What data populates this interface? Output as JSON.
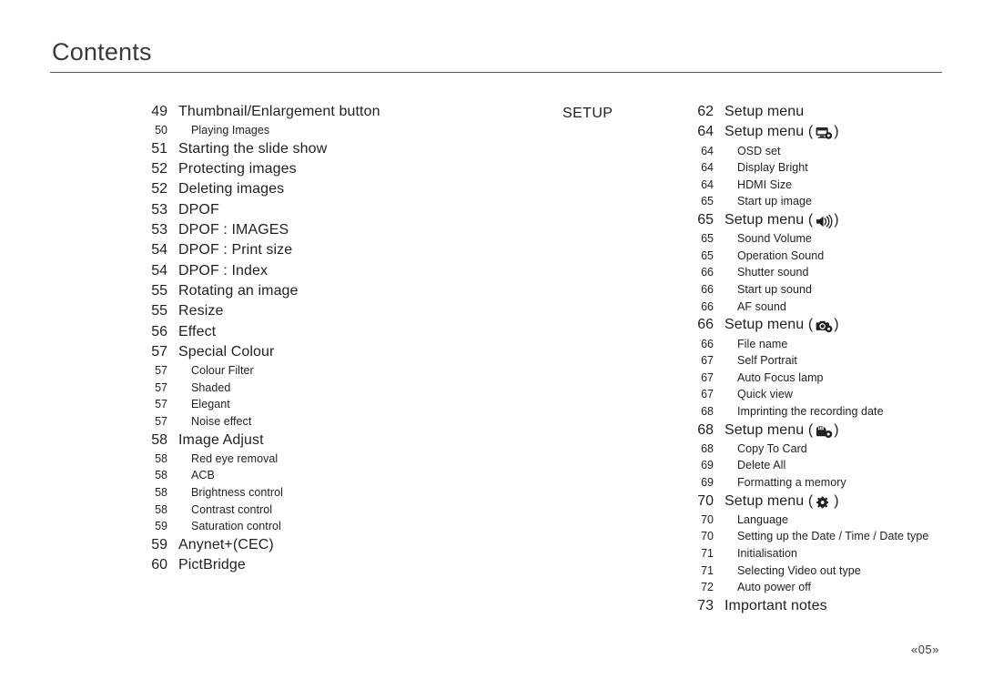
{
  "header": {
    "title": "Contents"
  },
  "footer": {
    "page_marker": "«05»"
  },
  "columns": {
    "left": {
      "section_label": "",
      "entries": [
        {
          "level": 1,
          "num": "49",
          "label": "Thumbnail/Enlargement button"
        },
        {
          "level": 2,
          "num": "50",
          "label": "Playing Images"
        },
        {
          "level": 1,
          "num": "51",
          "label": "Starting the slide show"
        },
        {
          "level": 1,
          "num": "52",
          "label": "Protecting images"
        },
        {
          "level": 1,
          "num": "52",
          "label": "Deleting images"
        },
        {
          "level": 1,
          "num": "53",
          "label": "DPOF"
        },
        {
          "level": 1,
          "num": "53",
          "label": "DPOF : IMAGES"
        },
        {
          "level": 1,
          "num": "54",
          "label": "DPOF : Print size"
        },
        {
          "level": 1,
          "num": "54",
          "label": "DPOF : Index"
        },
        {
          "level": 1,
          "num": "55",
          "label": "Rotating an image"
        },
        {
          "level": 1,
          "num": "55",
          "label": "Resize"
        },
        {
          "level": 1,
          "num": "56",
          "label": "Effect"
        },
        {
          "level": 1,
          "num": "57",
          "label": "Special Colour"
        },
        {
          "level": 2,
          "num": "57",
          "label": "Colour Filter"
        },
        {
          "level": 2,
          "num": "57",
          "label": "Shaded"
        },
        {
          "level": 2,
          "num": "57",
          "label": "Elegant"
        },
        {
          "level": 2,
          "num": "57",
          "label": "Noise effect"
        },
        {
          "level": 1,
          "num": "58",
          "label": "Image Adjust"
        },
        {
          "level": 2,
          "num": "58",
          "label": "Red eye removal"
        },
        {
          "level": 2,
          "num": "58",
          "label": "ACB"
        },
        {
          "level": 2,
          "num": "58",
          "label": "Brightness control"
        },
        {
          "level": 2,
          "num": "58",
          "label": "Contrast control"
        },
        {
          "level": 2,
          "num": "59",
          "label": "Saturation control"
        },
        {
          "level": 1,
          "num": "59",
          "label": "Anynet+(CEC)"
        },
        {
          "level": 1,
          "num": "60",
          "label": "PictBridge"
        }
      ]
    },
    "right": {
      "section_label": "SETUP",
      "entries": [
        {
          "level": 1,
          "num": "62",
          "label": "Setup menu"
        },
        {
          "level": 1,
          "num": "64",
          "label": "Setup menu",
          "icon": "display-settings-icon"
        },
        {
          "level": 2,
          "num": "64",
          "label": "OSD set"
        },
        {
          "level": 2,
          "num": "64",
          "label": "Display Bright"
        },
        {
          "level": 2,
          "num": "64",
          "label": "HDMI Size"
        },
        {
          "level": 2,
          "num": "65",
          "label": "Start up image"
        },
        {
          "level": 1,
          "num": "65",
          "label": "Setup menu",
          "icon": "speaker-sound-icon"
        },
        {
          "level": 2,
          "num": "65",
          "label": "Sound Volume"
        },
        {
          "level": 2,
          "num": "65",
          "label": "Operation Sound"
        },
        {
          "level": 2,
          "num": "66",
          "label": "Shutter sound"
        },
        {
          "level": 2,
          "num": "66",
          "label": "Start up sound"
        },
        {
          "level": 2,
          "num": "66",
          "label": "AF sound"
        },
        {
          "level": 1,
          "num": "66",
          "label": "Setup menu",
          "icon": "camera-settings-icon"
        },
        {
          "level": 2,
          "num": "66",
          "label": "File name"
        },
        {
          "level": 2,
          "num": "67",
          "label": "Self Portrait"
        },
        {
          "level": 2,
          "num": "67",
          "label": "Auto Focus lamp"
        },
        {
          "level": 2,
          "num": "67",
          "label": "Quick view"
        },
        {
          "level": 2,
          "num": "68",
          "label": "Imprinting the recording date"
        },
        {
          "level": 1,
          "num": "68",
          "label": "Setup menu",
          "icon": "memory-card-settings-icon"
        },
        {
          "level": 2,
          "num": "68",
          "label": "Copy To Card"
        },
        {
          "level": 2,
          "num": "69",
          "label": "Delete All"
        },
        {
          "level": 2,
          "num": "69",
          "label": "Formatting a memory"
        },
        {
          "level": 1,
          "num": "70",
          "label": "Setup menu",
          "icon": "gear-icon"
        },
        {
          "level": 2,
          "num": "70",
          "label": "Language"
        },
        {
          "level": 2,
          "num": "70",
          "label": "Setting up the Date / Time / Date type"
        },
        {
          "level": 2,
          "num": "71",
          "label": "Initialisation"
        },
        {
          "level": 2,
          "num": "71",
          "label": "Selecting Video out type"
        },
        {
          "level": 2,
          "num": "72",
          "label": "Auto power off"
        },
        {
          "level": 1,
          "num": "73",
          "label": "Important notes"
        }
      ]
    }
  },
  "icon_parens": {
    "open": "(",
    "close": ")"
  },
  "colors": {
    "text": "#231f20",
    "rule": "#58585b",
    "header_text": "#3a3a3c"
  }
}
